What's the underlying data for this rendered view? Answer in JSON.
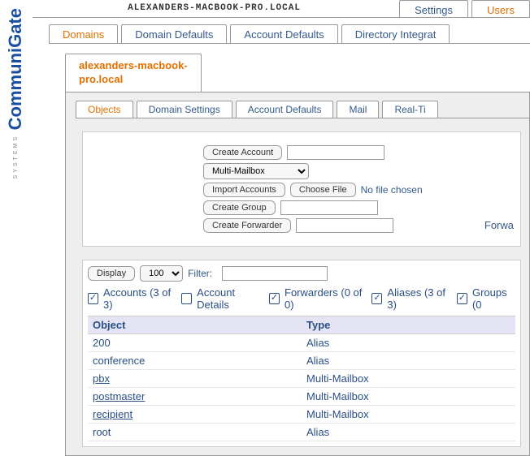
{
  "logo": {
    "main": "CommuniGate",
    "sub": "SYSTEMS"
  },
  "topbar": {
    "domain": "ALEXANDERS-MACBOOK-PRO.LOCAL",
    "tabs": [
      {
        "label": "Settings",
        "active": false
      },
      {
        "label": "Users",
        "active": true
      }
    ]
  },
  "mainTabs": [
    {
      "label": "Domains",
      "active": true
    },
    {
      "label": "Domain Defaults",
      "active": false
    },
    {
      "label": "Account Defaults",
      "active": false
    },
    {
      "label": "Directory Integrat",
      "active": false
    }
  ],
  "domainTab": "alexanders-macbook-\npro.local",
  "subTabs": [
    {
      "label": "Objects",
      "active": true
    },
    {
      "label": "Domain Settings",
      "active": false
    },
    {
      "label": "Account Defaults",
      "active": false
    },
    {
      "label": "Mail",
      "active": false
    },
    {
      "label": "Real-Ti",
      "active": false
    }
  ],
  "form": {
    "createAccount": "Create Account",
    "mailboxType": "Multi-Mailbox",
    "importAccounts": "Import Accounts",
    "chooseFile": "Choose File",
    "noFile": "No file chosen",
    "createGroup": "Create Group",
    "createForwarder": "Create Forwarder",
    "forwa": "Forwa"
  },
  "filter": {
    "display": "Display",
    "count": "100",
    "label": "Filter:",
    "value": ""
  },
  "checks": {
    "accounts": {
      "label": "Accounts (3 of 3)",
      "checked": true
    },
    "details": {
      "label": "Account Details",
      "checked": false
    },
    "forwarders": {
      "label": "Forwarders (0 of 0)",
      "checked": true
    },
    "aliases": {
      "label": "Aliases (3 of 3)",
      "checked": true
    },
    "groups": {
      "label": "Groups (0",
      "checked": true
    }
  },
  "table": {
    "cols": [
      "Object",
      "Type"
    ],
    "rows": [
      {
        "object": "200",
        "type": "Alias",
        "link": false
      },
      {
        "object": "conference",
        "type": "Alias",
        "link": false
      },
      {
        "object": "pbx",
        "type": "Multi-Mailbox",
        "link": true
      },
      {
        "object": "postmaster",
        "type": "Multi-Mailbox",
        "link": true
      },
      {
        "object": "recipient",
        "type": "Multi-Mailbox",
        "link": true
      },
      {
        "object": "root",
        "type": "Alias",
        "link": false
      }
    ]
  }
}
